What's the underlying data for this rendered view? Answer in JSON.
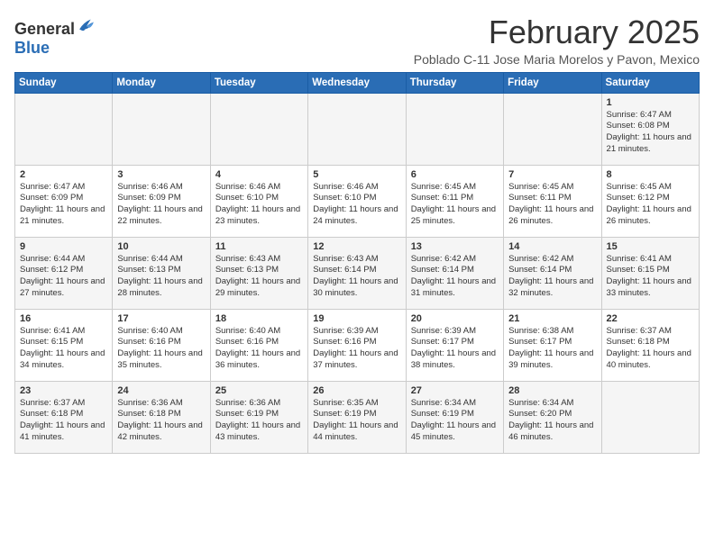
{
  "logo": {
    "general": "General",
    "blue": "Blue"
  },
  "title": "February 2025",
  "subtitle": "Poblado C-11 Jose Maria Morelos y Pavon, Mexico",
  "weekdays": [
    "Sunday",
    "Monday",
    "Tuesday",
    "Wednesday",
    "Thursday",
    "Friday",
    "Saturday"
  ],
  "weeks": [
    [
      null,
      null,
      null,
      null,
      null,
      null,
      {
        "day": "1",
        "sunrise": "6:47 AM",
        "sunset": "6:08 PM",
        "daylight": "11 hours and 21 minutes."
      }
    ],
    [
      {
        "day": "2",
        "sunrise": "6:47 AM",
        "sunset": "6:09 PM",
        "daylight": "11 hours and 21 minutes."
      },
      {
        "day": "3",
        "sunrise": "6:46 AM",
        "sunset": "6:09 PM",
        "daylight": "11 hours and 22 minutes."
      },
      {
        "day": "4",
        "sunrise": "6:46 AM",
        "sunset": "6:10 PM",
        "daylight": "11 hours and 23 minutes."
      },
      {
        "day": "5",
        "sunrise": "6:46 AM",
        "sunset": "6:10 PM",
        "daylight": "11 hours and 24 minutes."
      },
      {
        "day": "6",
        "sunrise": "6:45 AM",
        "sunset": "6:11 PM",
        "daylight": "11 hours and 25 minutes."
      },
      {
        "day": "7",
        "sunrise": "6:45 AM",
        "sunset": "6:11 PM",
        "daylight": "11 hours and 26 minutes."
      },
      {
        "day": "8",
        "sunrise": "6:45 AM",
        "sunset": "6:12 PM",
        "daylight": "11 hours and 26 minutes."
      }
    ],
    [
      {
        "day": "9",
        "sunrise": "6:44 AM",
        "sunset": "6:12 PM",
        "daylight": "11 hours and 27 minutes."
      },
      {
        "day": "10",
        "sunrise": "6:44 AM",
        "sunset": "6:13 PM",
        "daylight": "11 hours and 28 minutes."
      },
      {
        "day": "11",
        "sunrise": "6:43 AM",
        "sunset": "6:13 PM",
        "daylight": "11 hours and 29 minutes."
      },
      {
        "day": "12",
        "sunrise": "6:43 AM",
        "sunset": "6:14 PM",
        "daylight": "11 hours and 30 minutes."
      },
      {
        "day": "13",
        "sunrise": "6:42 AM",
        "sunset": "6:14 PM",
        "daylight": "11 hours and 31 minutes."
      },
      {
        "day": "14",
        "sunrise": "6:42 AM",
        "sunset": "6:14 PM",
        "daylight": "11 hours and 32 minutes."
      },
      {
        "day": "15",
        "sunrise": "6:41 AM",
        "sunset": "6:15 PM",
        "daylight": "11 hours and 33 minutes."
      }
    ],
    [
      {
        "day": "16",
        "sunrise": "6:41 AM",
        "sunset": "6:15 PM",
        "daylight": "11 hours and 34 minutes."
      },
      {
        "day": "17",
        "sunrise": "6:40 AM",
        "sunset": "6:16 PM",
        "daylight": "11 hours and 35 minutes."
      },
      {
        "day": "18",
        "sunrise": "6:40 AM",
        "sunset": "6:16 PM",
        "daylight": "11 hours and 36 minutes."
      },
      {
        "day": "19",
        "sunrise": "6:39 AM",
        "sunset": "6:16 PM",
        "daylight": "11 hours and 37 minutes."
      },
      {
        "day": "20",
        "sunrise": "6:39 AM",
        "sunset": "6:17 PM",
        "daylight": "11 hours and 38 minutes."
      },
      {
        "day": "21",
        "sunrise": "6:38 AM",
        "sunset": "6:17 PM",
        "daylight": "11 hours and 39 minutes."
      },
      {
        "day": "22",
        "sunrise": "6:37 AM",
        "sunset": "6:18 PM",
        "daylight": "11 hours and 40 minutes."
      }
    ],
    [
      {
        "day": "23",
        "sunrise": "6:37 AM",
        "sunset": "6:18 PM",
        "daylight": "11 hours and 41 minutes."
      },
      {
        "day": "24",
        "sunrise": "6:36 AM",
        "sunset": "6:18 PM",
        "daylight": "11 hours and 42 minutes."
      },
      {
        "day": "25",
        "sunrise": "6:36 AM",
        "sunset": "6:19 PM",
        "daylight": "11 hours and 43 minutes."
      },
      {
        "day": "26",
        "sunrise": "6:35 AM",
        "sunset": "6:19 PM",
        "daylight": "11 hours and 44 minutes."
      },
      {
        "day": "27",
        "sunrise": "6:34 AM",
        "sunset": "6:19 PM",
        "daylight": "11 hours and 45 minutes."
      },
      {
        "day": "28",
        "sunrise": "6:34 AM",
        "sunset": "6:20 PM",
        "daylight": "11 hours and 46 minutes."
      },
      null
    ]
  ]
}
